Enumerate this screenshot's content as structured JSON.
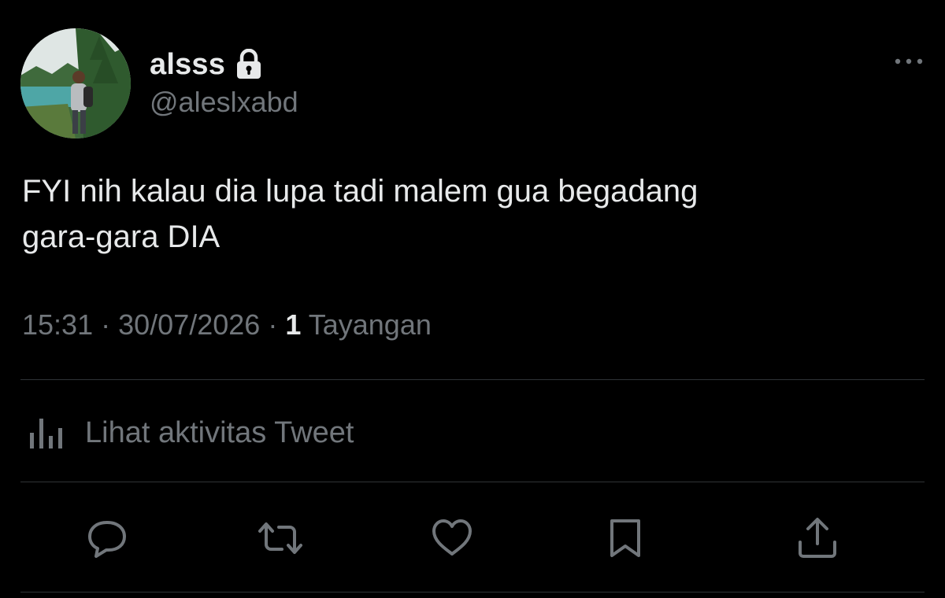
{
  "author": {
    "display_name": "alsss",
    "handle": "@aleslxabd",
    "protected_icon": "lock-icon",
    "avatar": "profile-photo"
  },
  "tweet": {
    "text_line_1": "FYI nih kalau dia lupa tadi malem gua begadang",
    "text_line_2": "gara-gara DIA",
    "time": "15:31",
    "separator": "·",
    "date": "30/07/2026",
    "views_count": "1",
    "views_label": "Tayangan"
  },
  "activity": {
    "icon": "analytics-icon",
    "label": "Lihat aktivitas Tweet"
  },
  "actions": [
    {
      "icon": "reply-icon"
    },
    {
      "icon": "retweet-icon"
    },
    {
      "icon": "like-icon"
    },
    {
      "icon": "bookmark-icon"
    },
    {
      "icon": "share-icon"
    }
  ],
  "colors": {
    "background": "#000000",
    "primary_text": "#e7e9ea",
    "secondary_text": "#71767b",
    "divider": "#2f3336"
  }
}
